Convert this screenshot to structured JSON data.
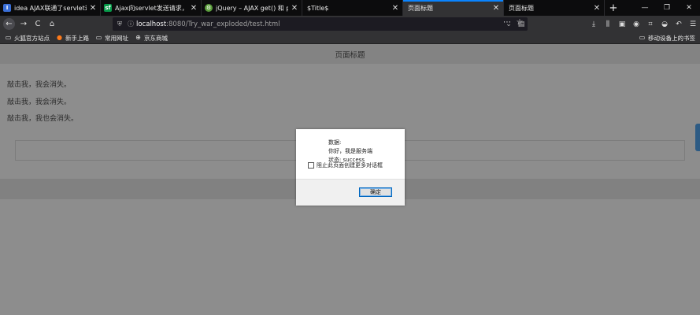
{
  "tabs": [
    {
      "title": "idea AJAX联通了servlet却收",
      "favicon": "I",
      "fav_color": "#3a6fd8",
      "active": false
    },
    {
      "title": "Ajax向servlet发送请求，接受",
      "favicon": "sf",
      "fav_color": "#079b4a",
      "active": false
    },
    {
      "title": "jQuery – AJAX get() 和 post",
      "favicon": "⚙",
      "fav_color": "#5b9e3c",
      "active": false
    },
    {
      "title": "$Title$",
      "favicon": "",
      "fav_color": "#0c0c0d",
      "active": false
    },
    {
      "title": "页面标题",
      "favicon": "",
      "fav_color": "#323234",
      "active": true
    },
    {
      "title": "页面标题",
      "favicon": "",
      "fav_color": "#0c0c0d",
      "active": false
    }
  ],
  "tab_close_glyph": "✕",
  "new_tab_glyph": "+",
  "window_controls": {
    "minimize": "—",
    "maximize": "❐",
    "close": "✕"
  },
  "nav": {
    "back": "←",
    "forward": "→",
    "reload": "C",
    "home": "⌂"
  },
  "url": {
    "host": "localhost",
    "path": ":8080/Try_war_exploded/test.html"
  },
  "bookmarks": [
    {
      "label": "火狐官方站点",
      "icon": "folder-icon"
    },
    {
      "label": "新手上路",
      "icon": "firefox-icon"
    },
    {
      "label": "常用网址",
      "icon": "folder-icon"
    },
    {
      "label": "京东商城",
      "icon": "globe-icon"
    }
  ],
  "bookmarks_right": "移动设备上的书签",
  "page": {
    "header_title": "页面标题",
    "lines": [
      "敲击我，我会消失。",
      "敲击我，我会消失。",
      "敲击我，我也会消失。"
    ]
  },
  "dialog": {
    "message_lines": [
      "数据:",
      "你好，我是服务端",
      "状态: success"
    ],
    "checkbox_label": "阻止此页面创建更多对话框",
    "ok_label": "确定"
  },
  "colors": {
    "accent": "#0a84ff",
    "page_bg": "#8d8d8d",
    "toolbar": "#323234"
  }
}
